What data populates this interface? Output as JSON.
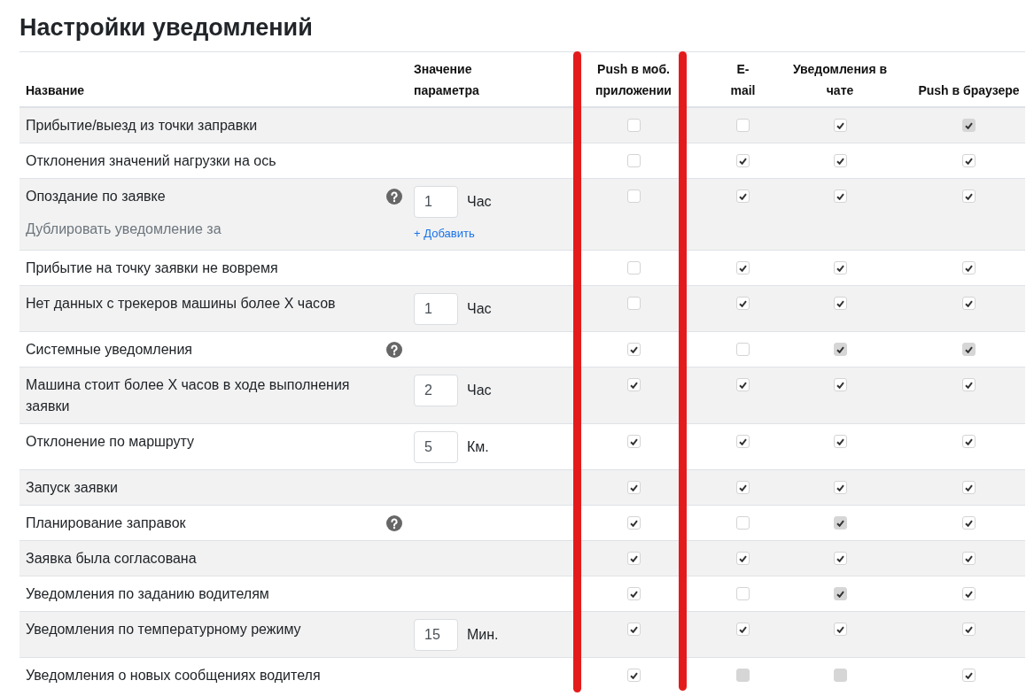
{
  "page": {
    "title": "Настройки уведомлений"
  },
  "table": {
    "columns": [
      {
        "label": "Название",
        "highlighted": false
      },
      {
        "label": "Значение параметра",
        "highlighted": false
      },
      {
        "label": "Push в моб. приложении",
        "highlighted": true
      },
      {
        "label": "E-mail",
        "highlighted": false
      },
      {
        "label": "Уведомления в чате",
        "highlighted": false
      },
      {
        "label": "Push в браузере",
        "highlighted": false
      }
    ],
    "rows": [
      {
        "name": "Прибытие/выезд из точки заправки",
        "help": false,
        "channels": [
          {
            "checked": false,
            "disabled": false
          },
          {
            "checked": false,
            "disabled": false
          },
          {
            "checked": true,
            "disabled": false
          },
          {
            "checked": true,
            "disabled": true
          }
        ]
      },
      {
        "name": "Отклонения значений нагрузки на ось",
        "help": false,
        "channels": [
          {
            "checked": false,
            "disabled": false
          },
          {
            "checked": true,
            "disabled": false
          },
          {
            "checked": true,
            "disabled": false
          },
          {
            "checked": true,
            "disabled": false
          }
        ]
      },
      {
        "name": "Опоздание по заявке",
        "help": true,
        "subtext": "Дублировать уведомление за",
        "parameter": {
          "value": "1",
          "unit": "Час"
        },
        "add_link": "+ Добавить",
        "channels": [
          {
            "checked": false,
            "disabled": false
          },
          {
            "checked": true,
            "disabled": false
          },
          {
            "checked": true,
            "disabled": false
          },
          {
            "checked": true,
            "disabled": false
          }
        ]
      },
      {
        "name": "Прибытие на точку заявки не вовремя",
        "help": false,
        "channels": [
          {
            "checked": false,
            "disabled": false
          },
          {
            "checked": true,
            "disabled": false
          },
          {
            "checked": true,
            "disabled": false
          },
          {
            "checked": true,
            "disabled": false
          }
        ]
      },
      {
        "name": "Нет данных с трекеров машины более X часов",
        "help": false,
        "parameter": {
          "value": "1",
          "unit": "Час"
        },
        "channels": [
          {
            "checked": false,
            "disabled": false
          },
          {
            "checked": true,
            "disabled": false
          },
          {
            "checked": true,
            "disabled": false
          },
          {
            "checked": true,
            "disabled": false
          }
        ]
      },
      {
        "name": "Системные уведомления",
        "help": true,
        "channels": [
          {
            "checked": true,
            "disabled": false
          },
          {
            "checked": false,
            "disabled": false
          },
          {
            "checked": true,
            "disabled": true
          },
          {
            "checked": true,
            "disabled": true
          }
        ]
      },
      {
        "name": "Машина стоит более X часов в ходе выполнения заявки",
        "help": false,
        "parameter": {
          "value": "2",
          "unit": "Час"
        },
        "channels": [
          {
            "checked": true,
            "disabled": false
          },
          {
            "checked": true,
            "disabled": false
          },
          {
            "checked": true,
            "disabled": false
          },
          {
            "checked": true,
            "disabled": false
          }
        ]
      },
      {
        "name": "Отклонение по маршруту",
        "help": false,
        "parameter": {
          "value": "5",
          "unit": "Км."
        },
        "channels": [
          {
            "checked": true,
            "disabled": false
          },
          {
            "checked": true,
            "disabled": false
          },
          {
            "checked": true,
            "disabled": false
          },
          {
            "checked": true,
            "disabled": false
          }
        ]
      },
      {
        "name": "Запуск заявки",
        "help": false,
        "channels": [
          {
            "checked": true,
            "disabled": false
          },
          {
            "checked": true,
            "disabled": false
          },
          {
            "checked": true,
            "disabled": false
          },
          {
            "checked": true,
            "disabled": false
          }
        ]
      },
      {
        "name": "Планирование заправок",
        "help": true,
        "channels": [
          {
            "checked": true,
            "disabled": false
          },
          {
            "checked": false,
            "disabled": false
          },
          {
            "checked": true,
            "disabled": true
          },
          {
            "checked": true,
            "disabled": false
          }
        ]
      },
      {
        "name": "Заявка была согласована",
        "help": false,
        "channels": [
          {
            "checked": true,
            "disabled": false
          },
          {
            "checked": true,
            "disabled": false
          },
          {
            "checked": true,
            "disabled": false
          },
          {
            "checked": true,
            "disabled": false
          }
        ]
      },
      {
        "name": "Уведомления по заданию водителям",
        "help": false,
        "channels": [
          {
            "checked": true,
            "disabled": false
          },
          {
            "checked": false,
            "disabled": false
          },
          {
            "checked": true,
            "disabled": true
          },
          {
            "checked": true,
            "disabled": false
          }
        ]
      },
      {
        "name": "Уведомления по температурному режиму",
        "help": false,
        "parameter": {
          "value": "15",
          "unit": "Мин."
        },
        "channels": [
          {
            "checked": true,
            "disabled": false
          },
          {
            "checked": true,
            "disabled": false
          },
          {
            "checked": true,
            "disabled": false
          },
          {
            "checked": true,
            "disabled": false
          }
        ]
      },
      {
        "name": "Уведомления о новых сообщениях водителя",
        "help": false,
        "channels": [
          {
            "checked": true,
            "disabled": false
          },
          {
            "checked": false,
            "disabled": true
          },
          {
            "checked": false,
            "disabled": true
          },
          {
            "checked": true,
            "disabled": false
          }
        ]
      }
    ]
  }
}
